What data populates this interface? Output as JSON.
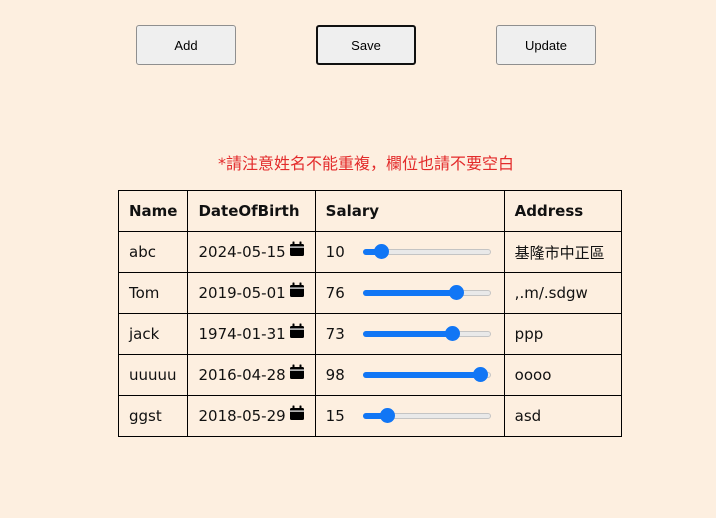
{
  "buttons": {
    "add": "Add",
    "save": "Save",
    "update": "Update"
  },
  "notice": "*請注意姓名不能重複，欄位也請不要空白",
  "table": {
    "headers": [
      "Name",
      "DateOfBirth",
      "Salary",
      "Address"
    ],
    "rows": [
      {
        "name": "abc",
        "dob": "2024-05-15",
        "salary": "10",
        "address": "基隆市中正區"
      },
      {
        "name": "Tom",
        "dob": "2019-05-01",
        "salary": "76",
        "address": ",.m/.sdgw"
      },
      {
        "name": "jack",
        "dob": "1974-01-31",
        "salary": "73",
        "address": "ppp"
      },
      {
        "name": "uuuuu",
        "dob": "2016-04-28",
        "salary": "98",
        "address": "oooo"
      },
      {
        "name": "ggst",
        "dob": "2018-05-29",
        "salary": "15",
        "address": "asd"
      }
    ]
  },
  "slider": {
    "max": 100
  },
  "colors": {
    "background": "#fdefe0",
    "notice": "#e32b2b",
    "slider_accent": "#1176f5"
  },
  "icons": {
    "date_picker": "calendar-icon"
  }
}
